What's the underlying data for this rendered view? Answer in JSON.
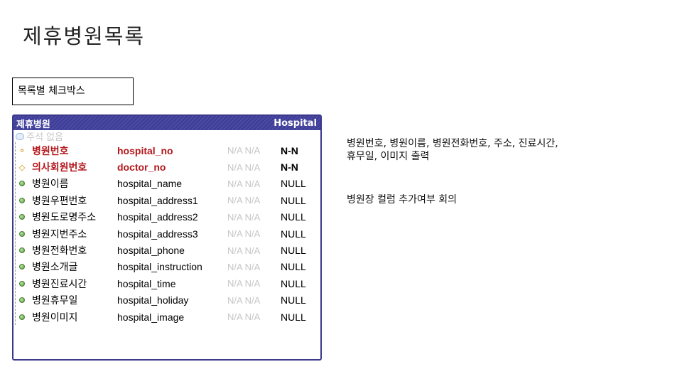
{
  "slide": {
    "title": "제휴병원목록",
    "label_box": "목록별 체크박스"
  },
  "entity": {
    "name_kr": "제휴병원",
    "name_en": "Hospital",
    "comment": "주석 없음",
    "rows": [
      {
        "kr": "병원번호",
        "en": "hospital_no",
        "na1": "N/A",
        "na2": "N/A",
        "null": "N-N",
        "type": "pk",
        "icon": "key-icon"
      },
      {
        "kr": "의사회원번호",
        "en": "doctor_no",
        "na1": "N/A",
        "na2": "N/A",
        "null": "N-N",
        "type": "pk",
        "icon": "foreign-key-icon"
      },
      {
        "kr": "병원이름",
        "en": "hospital_name",
        "na1": "N/A",
        "na2": "N/A",
        "null": "NULL",
        "type": "col",
        "icon": "column-dot-icon"
      },
      {
        "kr": "병원우편번호",
        "en": "hospital_address1",
        "na1": "N/A",
        "na2": "N/A",
        "null": "NULL",
        "type": "col",
        "icon": "column-dot-icon"
      },
      {
        "kr": "병원도로명주소",
        "en": "hospital_address2",
        "na1": "N/A",
        "na2": "N/A",
        "null": "NULL",
        "type": "col",
        "icon": "column-dot-icon"
      },
      {
        "kr": "병원지번주소",
        "en": "hospital_address3",
        "na1": "N/A",
        "na2": "N/A",
        "null": "NULL",
        "type": "col",
        "icon": "column-dot-icon"
      },
      {
        "kr": "병원전화번호",
        "en": "hospital_phone",
        "na1": "N/A",
        "na2": "N/A",
        "null": "NULL",
        "type": "col",
        "icon": "column-dot-icon"
      },
      {
        "kr": "병원소개글",
        "en": "hospital_instruction",
        "na1": "N/A",
        "na2": "N/A",
        "null": "NULL",
        "type": "col",
        "icon": "column-dot-icon"
      },
      {
        "kr": "병원진료시간",
        "en": "hospital_time",
        "na1": "N/A",
        "na2": "N/A",
        "null": "NULL",
        "type": "col",
        "icon": "column-dot-icon"
      },
      {
        "kr": "병원휴무일",
        "en": "hospital_holiday",
        "na1": "N/A",
        "na2": "N/A",
        "null": "NULL",
        "type": "col",
        "icon": "column-dot-icon"
      },
      {
        "kr": "병원이미지",
        "en": "hospital_image",
        "na1": "N/A",
        "na2": "N/A",
        "null": "NULL",
        "type": "col",
        "icon": "column-dot-icon"
      }
    ]
  },
  "notes": {
    "line1": "병원번호, 병원이름, 병원전화번호, 주소, 진료시간,",
    "line2": "휴무일, 이미지 출력",
    "line3": "병원장 컬럼 추가여부 회의"
  },
  "colors": {
    "header_bg": "#3e3d94",
    "pk_text": "#b3161b",
    "na_text": "#c6c6c6"
  }
}
